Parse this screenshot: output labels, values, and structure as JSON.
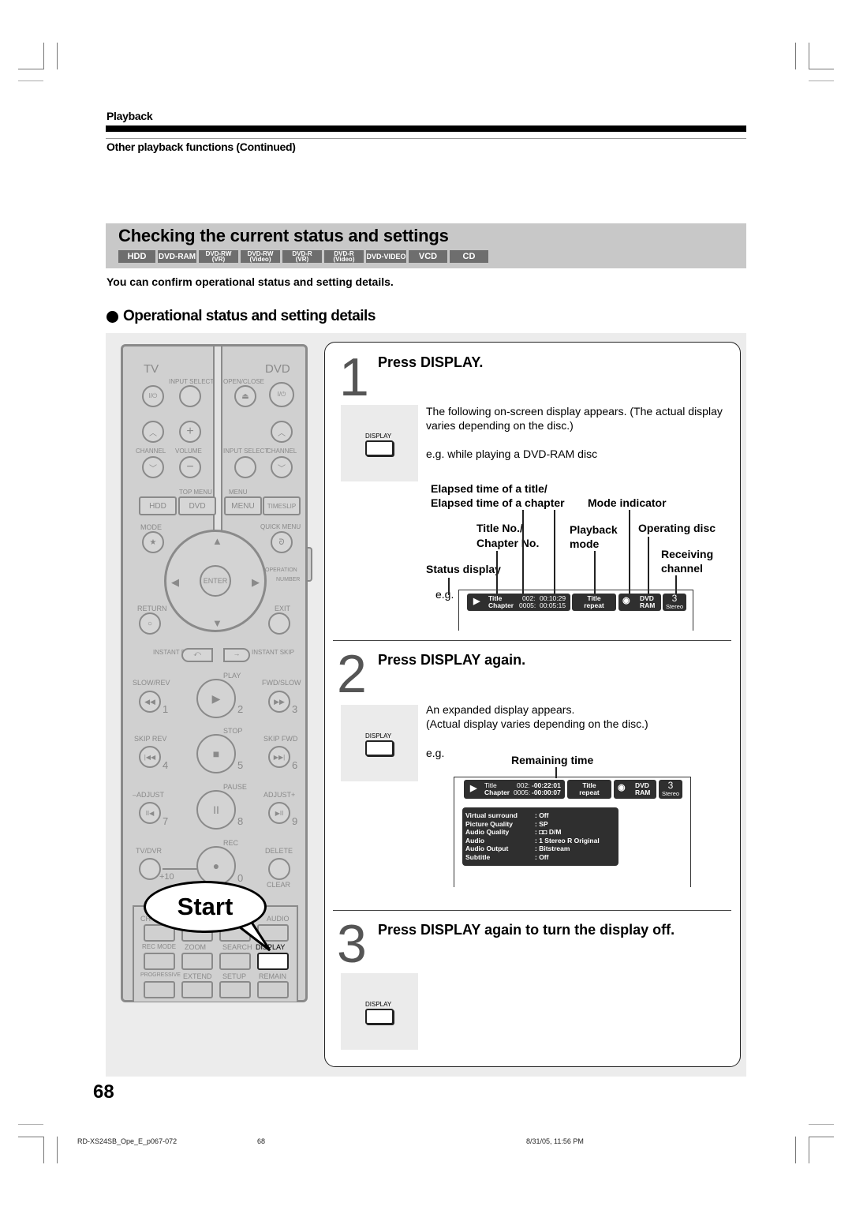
{
  "header": {
    "section": "Playback",
    "subsection": "Other playback functions (Continued)"
  },
  "title_band": {
    "title": "Checking the current status and settings",
    "discs": [
      {
        "label": "HDD"
      },
      {
        "label": "DVD-RAM"
      },
      {
        "line1": "DVD-RW",
        "line2": "(VR)"
      },
      {
        "line1": "DVD-RW",
        "line2": "(Video)"
      },
      {
        "line1": "DVD-R",
        "line2": "(VR)"
      },
      {
        "line1": "DVD-R",
        "line2": "(Video)"
      },
      {
        "label": "DVD-VIDEO"
      },
      {
        "label": "VCD"
      },
      {
        "label": "CD"
      }
    ]
  },
  "intro": "You can confirm operational status and setting details.",
  "op_heading": "Operational status and setting details",
  "remote": {
    "tv": "TV",
    "dvd": "DVD",
    "input_select": "INPUT SELECT",
    "open_close": "OPEN/CLOSE",
    "power": "I/⏻",
    "channel": "CHANNEL",
    "volume": "VOLUME",
    "input_select2": "INPUT SELECT",
    "channel2": "CHANNEL",
    "top_menu": "TOP MENU",
    "menu_label": "MENU",
    "hdd": "HDD",
    "dvd_btn": "DVD",
    "menu": "MENU",
    "timeslip": "TIMESLIP",
    "mode": "MODE",
    "quick_menu": "QUICK MENU",
    "operation": "OPERATION",
    "number": "NUMBER",
    "enter": "ENTER",
    "return": "RETURN",
    "exit": "EXIT",
    "instant_replay": "INSTANT REPLAY",
    "instant_skip": "INSTANT SKIP",
    "play": "PLAY",
    "slow_rev": "SLOW/REV",
    "fwd_slow": "FWD/SLOW",
    "stop": "STOP",
    "skip_rev": "SKIP REV",
    "skip_fwd": "SKIP FWD",
    "pause": "PAUSE",
    "adjust_minus": "–ADJUST",
    "adjust_plus": "ADJUST+",
    "rec": "REC",
    "tv_dvr": "TV/DVR",
    "delete": "DELETE",
    "clear": "CLEAR",
    "plus10": "+10",
    "n1": "1",
    "n2": "2",
    "n3": "3",
    "n4": "4",
    "n5": "5",
    "n6": "6",
    "n7": "7",
    "n8": "8",
    "n9": "9",
    "n0": "0",
    "ch": "CH",
    "audio": "AUDIO",
    "rec_mode": "REC MODE",
    "zoom": "ZOOM",
    "search": "SEARCH",
    "display": "DISPLAY",
    "progressive": "PROGRESSIVE",
    "extend": "EXTEND",
    "setup": "SETUP",
    "remain": "REMAIN",
    "start_bubble": "Start"
  },
  "steps": [
    {
      "num": "1",
      "title": "Press DISPLAY.",
      "button_label": "DISPLAY",
      "text1": "The following on-screen display appears. (The actual display varies depending on the disc.)",
      "text2": "e.g. while playing a DVD-RAM disc",
      "callouts": {
        "elapsed1": "Elapsed time of a title/",
        "elapsed2": "Elapsed time of a chapter",
        "mode_indicator": "Mode indicator",
        "title_no1": "Title No./",
        "title_no2": "Chapter No.",
        "playback1": "Playback",
        "playback2": "mode",
        "operating_disc": "Operating disc",
        "receiving1": "Receiving",
        "receiving2": "channel",
        "status_display": "Status display",
        "eg": "e.g."
      },
      "osd": {
        "play_icon": "▶",
        "title_label": "Title",
        "title_no": "002:",
        "title_time": "00:10:29",
        "chapter_label": "Chapter",
        "chapter_no": "0005:",
        "chapter_time": "00:05:15",
        "mode1": "Title",
        "mode2": "repeat",
        "disc1": "DVD",
        "disc2": "RAM",
        "channel": "3",
        "audio": "Stereo"
      }
    },
    {
      "num": "2",
      "title": "Press DISPLAY again.",
      "button_label": "DISPLAY",
      "text1": "An expanded display appears.",
      "text2": "(Actual display varies depending on the disc.)",
      "eg": "e.g.",
      "remaining": "Remaining time",
      "osd": {
        "play_icon": "▶",
        "title_label": "Title",
        "title_no": "002:",
        "title_time": "-00:22:01",
        "chapter_label": "Chapter",
        "chapter_no": "0005:",
        "chapter_time": "-00:00:07",
        "mode1": "Title",
        "mode2": "repeat",
        "disc1": "DVD",
        "disc2": "RAM",
        "channel": "3",
        "audio": "Stereo",
        "details": [
          {
            "k": "Virtual surround",
            "v": ": Off"
          },
          {
            "k": "Picture Quality",
            "v": ": SP"
          },
          {
            "k": "Audio Quality",
            "v": ": ◘◘ D/M"
          },
          {
            "k": "Audio",
            "v": ": 1 Stereo R Original"
          },
          {
            "k": "Audio Output",
            "v": ": Bitstream"
          },
          {
            "k": "Subtitle",
            "v": ":    Off"
          }
        ]
      }
    },
    {
      "num": "3",
      "title": "Press DISPLAY again to turn the display off.",
      "button_label": "DISPLAY"
    }
  ],
  "page_number": "68",
  "footer": {
    "file": "RD-XS24SB_Ope_E_p067-072",
    "page": "68",
    "date": "8/31/05, 11:56 PM"
  }
}
